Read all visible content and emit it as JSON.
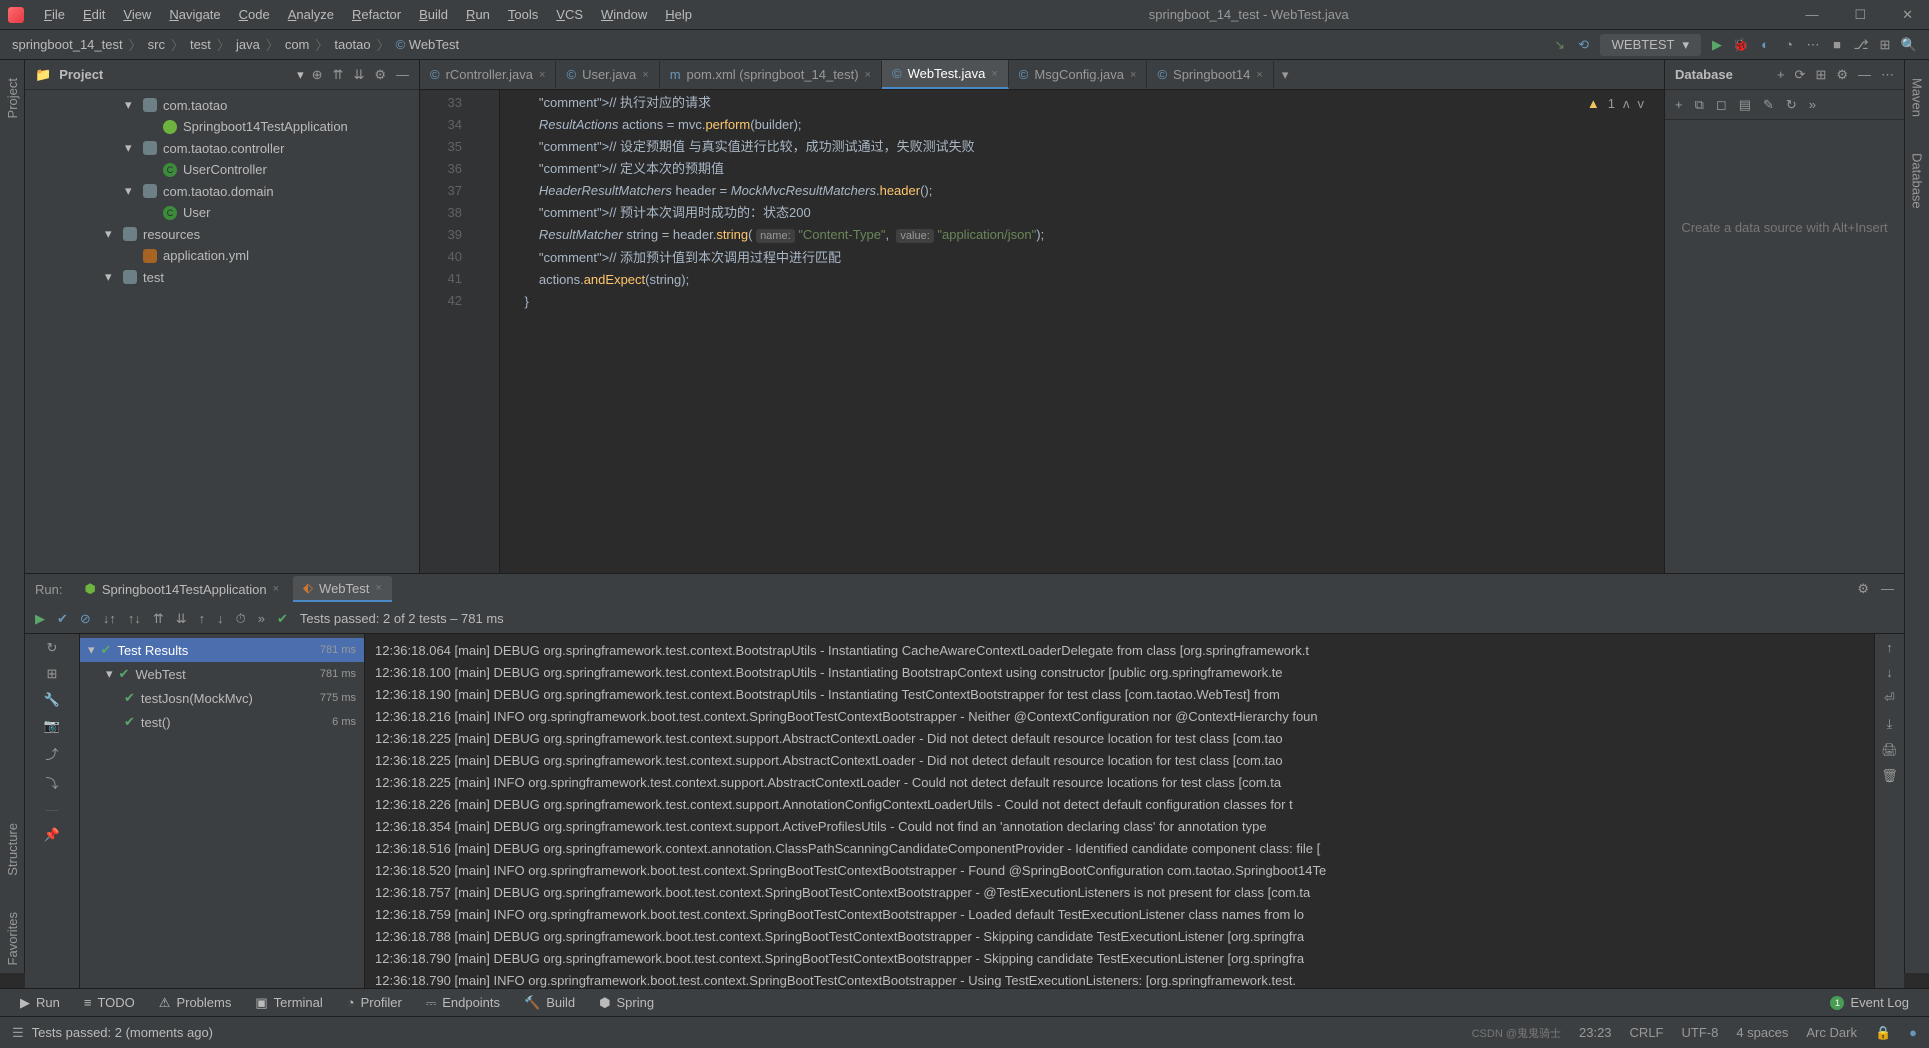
{
  "window": {
    "title": "springboot_14_test - WebTest.java",
    "menus": [
      "File",
      "Edit",
      "View",
      "Navigate",
      "Code",
      "Analyze",
      "Refactor",
      "Build",
      "Run",
      "Tools",
      "VCS",
      "Window",
      "Help"
    ]
  },
  "breadcrumbs": [
    "springboot_14_test",
    "src",
    "test",
    "java",
    "com",
    "taotao",
    "WebTest"
  ],
  "runConfig": "WEBTEST",
  "projectPanel": {
    "title": "Project",
    "tree": [
      {
        "indent": 1,
        "chevron": "▾",
        "icon": "pkg",
        "label": "com.taotao"
      },
      {
        "indent": 2,
        "chevron": "",
        "icon": "spring",
        "label": "Springboot14TestApplication"
      },
      {
        "indent": 1,
        "chevron": "▾",
        "icon": "pkg",
        "label": "com.taotao.controller"
      },
      {
        "indent": 2,
        "chevron": "",
        "icon": "class",
        "label": "UserController"
      },
      {
        "indent": 1,
        "chevron": "▾",
        "icon": "pkg",
        "label": "com.taotao.domain"
      },
      {
        "indent": 2,
        "chevron": "",
        "icon": "class",
        "label": "User"
      },
      {
        "indent": 0,
        "chevron": "▾",
        "icon": "folder",
        "label": "resources"
      },
      {
        "indent": 1,
        "chevron": "",
        "icon": "yml",
        "label": "application.yml"
      },
      {
        "indent": 0,
        "chevron": "▾",
        "icon": "folder",
        "label": "test"
      }
    ]
  },
  "editor": {
    "tabs": [
      {
        "label": "rController.java",
        "active": false,
        "icon": "class"
      },
      {
        "label": "User.java",
        "active": false,
        "icon": "class"
      },
      {
        "label": "pom.xml (springboot_14_test)",
        "active": false,
        "icon": "maven"
      },
      {
        "label": "WebTest.java",
        "active": true,
        "icon": "class"
      },
      {
        "label": "MsgConfig.java",
        "active": false,
        "icon": "class"
      },
      {
        "label": "Springboot14",
        "active": false,
        "icon": "class"
      }
    ],
    "warnings": "1",
    "lines": [
      {
        "n": 33,
        "code": "        // 执行对应的请求"
      },
      {
        "n": 34,
        "code": "        ResultActions actions = mvc.perform(builder);"
      },
      {
        "n": 35,
        "code": "        // 设定预期值 与真实值进行比较，成功测试通过，失败测试失败"
      },
      {
        "n": 36,
        "code": "        // 定义本次的预期值"
      },
      {
        "n": 37,
        "code": "        HeaderResultMatchers header = MockMvcResultMatchers.header();"
      },
      {
        "n": 38,
        "code": "        // 预计本次调用时成功的：状态200"
      },
      {
        "n": 39,
        "code": "        ResultMatcher string = header.string( name: \"Content-Type\",  value: \"application/json\");"
      },
      {
        "n": 40,
        "code": "        // 添加预计值到本次调用过程中进行匹配"
      },
      {
        "n": 41,
        "code": "        actions.andExpect(string);"
      },
      {
        "n": 42,
        "code": "    }"
      }
    ]
  },
  "database": {
    "title": "Database",
    "placeholder": "Create a data source with Alt+Insert"
  },
  "runPanel": {
    "label": "Run:",
    "tabs": [
      {
        "label": "Springboot14TestApplication",
        "active": false,
        "icon": "spring"
      },
      {
        "label": "WebTest",
        "active": true,
        "icon": "test"
      }
    ],
    "testStatus": "Tests passed: 2 of 2 tests – 781 ms",
    "testTree": [
      {
        "label": "Test Results",
        "time": "781 ms",
        "indent": 0,
        "selected": true
      },
      {
        "label": "WebTest",
        "time": "781 ms",
        "indent": 1,
        "selected": false
      },
      {
        "label": "testJosn(MockMvc)",
        "time": "775 ms",
        "indent": 2,
        "selected": false
      },
      {
        "label": "test()",
        "time": "6 ms",
        "indent": 2,
        "selected": false
      }
    ],
    "console": [
      "12:36:18.064 [main] DEBUG org.springframework.test.context.BootstrapUtils - Instantiating CacheAwareContextLoaderDelegate from class [org.springframework.t",
      "12:36:18.100 [main] DEBUG org.springframework.test.context.BootstrapUtils - Instantiating BootstrapContext using constructor [public org.springframework.te",
      "12:36:18.190 [main] DEBUG org.springframework.test.context.BootstrapUtils - Instantiating TestContextBootstrapper for test class [com.taotao.WebTest] from ",
      "12:36:18.216 [main] INFO org.springframework.boot.test.context.SpringBootTestContextBootstrapper - Neither @ContextConfiguration nor @ContextHierarchy foun",
      "12:36:18.225 [main] DEBUG org.springframework.test.context.support.AbstractContextLoader - Did not detect default resource location for test class [com.tao",
      "12:36:18.225 [main] DEBUG org.springframework.test.context.support.AbstractContextLoader - Did not detect default resource location for test class [com.tao",
      "12:36:18.225 [main] INFO org.springframework.test.context.support.AbstractContextLoader - Could not detect default resource locations for test class [com.ta",
      "12:36:18.226 [main] DEBUG org.springframework.test.context.support.AnnotationConfigContextLoaderUtils - Could not detect default configuration classes for t",
      "12:36:18.354 [main] DEBUG org.springframework.test.context.support.ActiveProfilesUtils - Could not find an 'annotation declaring class' for annotation type ",
      "12:36:18.516 [main] DEBUG org.springframework.context.annotation.ClassPathScanningCandidateComponentProvider - Identified candidate component class: file [",
      "12:36:18.520 [main] INFO org.springframework.boot.test.context.SpringBootTestContextBootstrapper - Found @SpringBootConfiguration com.taotao.Springboot14Te",
      "12:36:18.757 [main] DEBUG org.springframework.boot.test.context.SpringBootTestContextBootstrapper - @TestExecutionListeners is not present for class [com.ta",
      "12:36:18.759 [main] INFO org.springframework.boot.test.context.SpringBootTestContextBootstrapper - Loaded default TestExecutionListener class names from lo",
      "12:36:18.788 [main] DEBUG org.springframework.boot.test.context.SpringBootTestContextBootstrapper - Skipping candidate TestExecutionListener [org.springfra",
      "12:36:18.790 [main] DEBUG org.springframework.boot.test.context.SpringBootTestContextBootstrapper - Skipping candidate TestExecutionListener [org.springfra",
      "12:36:18.790 [main] INFO org.springframework.boot.test.context.SpringBootTestContextBootstrapper - Using TestExecutionListeners: [org.springframework.test."
    ]
  },
  "bottomTools": [
    "Run",
    "TODO",
    "Problems",
    "Terminal",
    "Profiler",
    "Endpoints",
    "Build",
    "Spring"
  ],
  "eventLog": {
    "label": "Event Log",
    "badge": "1"
  },
  "statusBar": {
    "message": "Tests passed: 2 (moments ago)",
    "cursor": "23:23",
    "lineEnding": "CRLF",
    "encoding": "UTF-8",
    "indent": "4 spaces",
    "theme": "Arc Dark",
    "watermark": "CSDN @鬼鬼骑士"
  }
}
